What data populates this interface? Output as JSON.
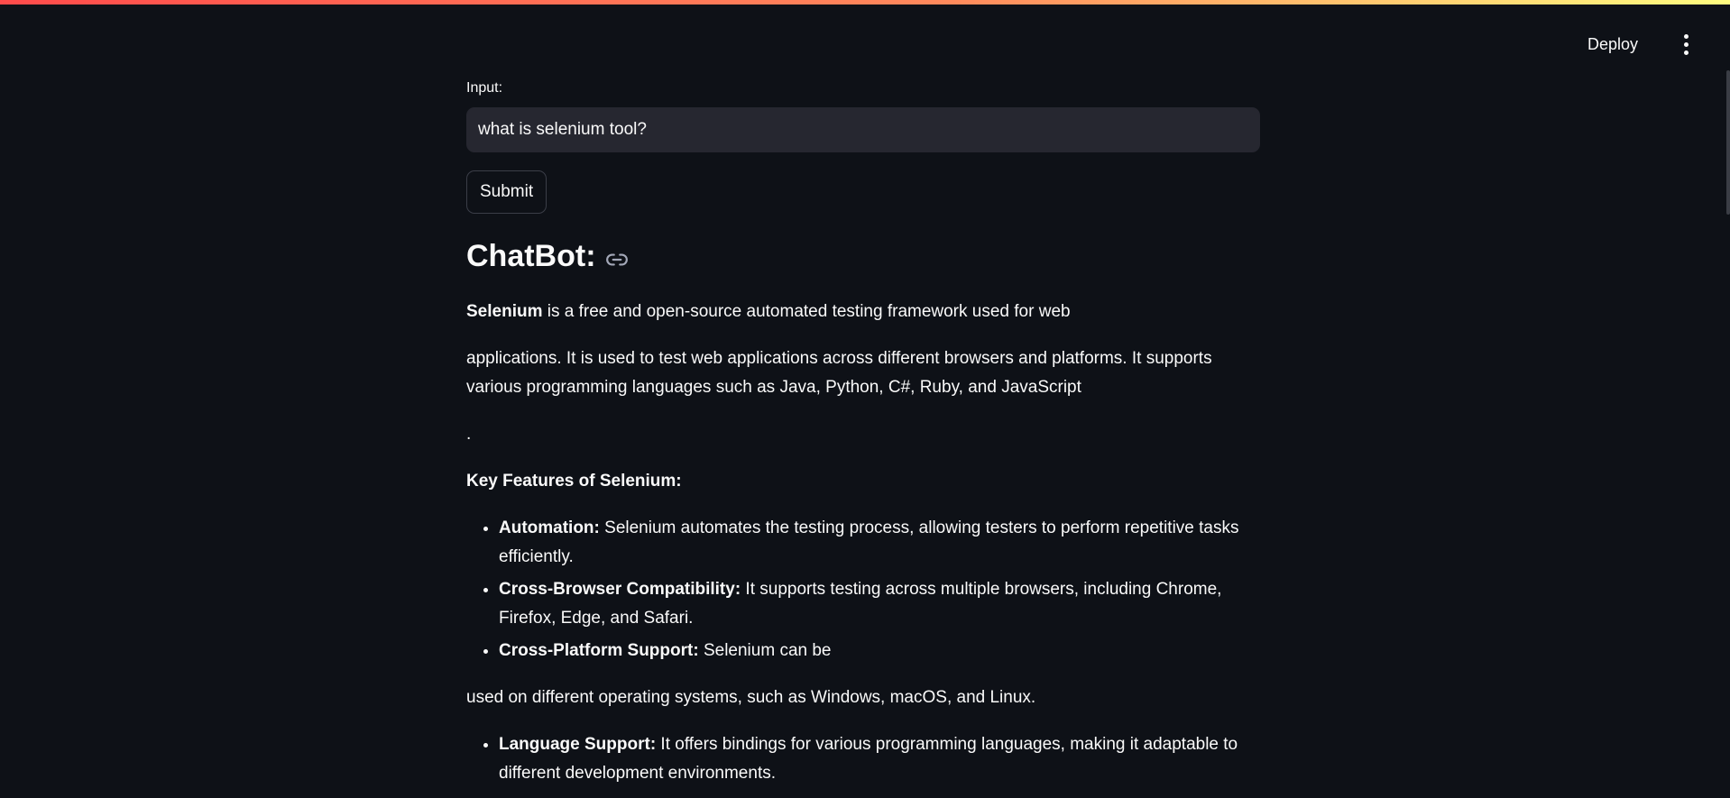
{
  "header": {
    "deploy_label": "Deploy",
    "menu_icon": "vertical-ellipsis-icon"
  },
  "form": {
    "input_label": "Input:",
    "input_value": "what is selenium tool?",
    "submit_label": "Submit"
  },
  "response": {
    "heading": "ChatBot:",
    "heading_icon": "link-icon",
    "intro_bold": "Selenium",
    "intro_rest": " is a free and open-source automated testing framework used for web",
    "para2": "applications. It is used to test web applications across different browsers and platforms. It supports various programming languages such as Java, Python, C#, Ruby, and JavaScript",
    "para3": ".",
    "features_heading": "Key Features of Selenium:",
    "features": [
      {
        "title": "Automation:",
        "text": " Selenium automates the testing process, allowing testers to perform repetitive tasks efficiently."
      },
      {
        "title": "Cross-Browser Compatibility:",
        "text": " It supports testing across multiple browsers, including Chrome, Firefox, Edge, and Safari."
      },
      {
        "title": "Cross-Platform Support:",
        "text": " Selenium can be"
      }
    ],
    "para_continued": "used on different operating systems, such as Windows, macOS, and Linux.",
    "features2": [
      {
        "title": "Language Support:",
        "text": " It offers bindings for various programming languages, making it adaptable to different development environments."
      }
    ]
  },
  "colors": {
    "background": "#0e1117",
    "text": "#fafafa",
    "input_bg": "#262730",
    "accent_gradient_start": "#ff4b4b",
    "accent_gradient_end": "#fffd80"
  }
}
